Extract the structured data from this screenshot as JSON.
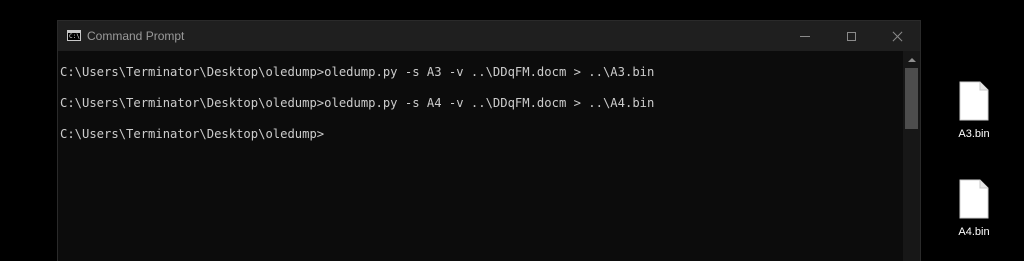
{
  "window": {
    "title": "Command Prompt",
    "icon": "console-icon",
    "icon_glyph": "C:\\",
    "controls": [
      "minimize-icon",
      "maximize-icon",
      "close-icon"
    ]
  },
  "console": {
    "lines": [
      "C:\\Users\\Terminator\\Desktop\\oledump>oledump.py -s A3 -v ..\\DDqFM.docm > ..\\A3.bin",
      "C:\\Users\\Terminator\\Desktop\\oledump>oledump.py -s A4 -v ..\\DDqFM.docm > ..\\A4.bin",
      "C:\\Users\\Terminator\\Desktop\\oledump>"
    ]
  },
  "desktop": {
    "items": [
      {
        "label": "A3.bin",
        "icon": "file-icon"
      },
      {
        "label": "A4.bin",
        "icon": "file-icon"
      }
    ]
  },
  "colors": {
    "console_bg": "#0c0c0c",
    "console_text": "#cccccc",
    "titlebar_bg": "#1f1f1f",
    "desktop_bg": "#000000"
  }
}
